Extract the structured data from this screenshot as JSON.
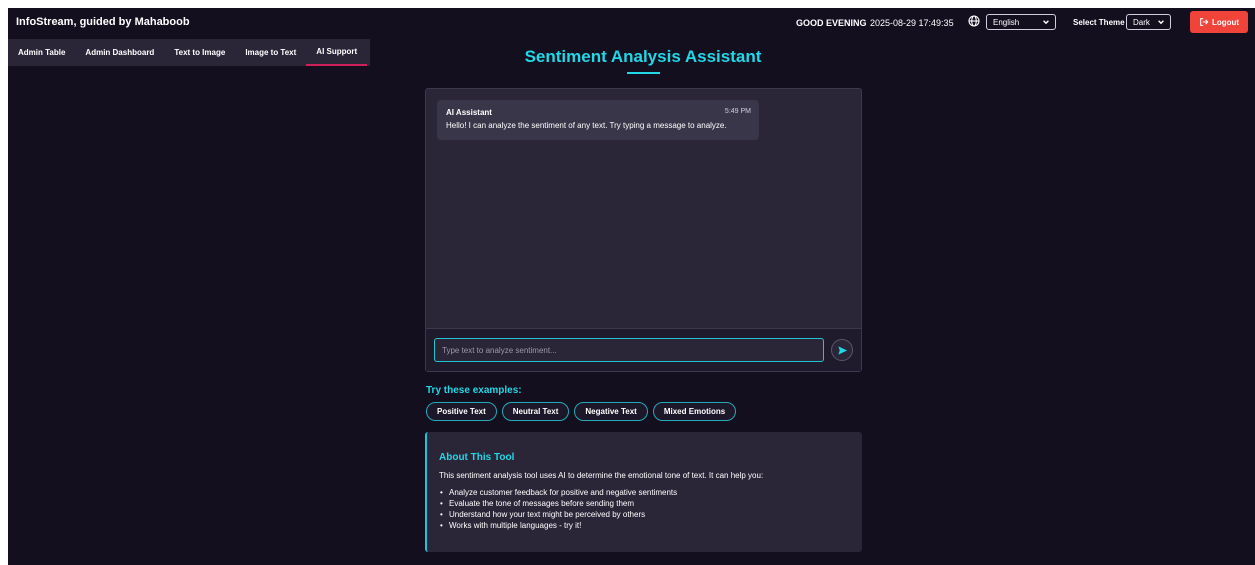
{
  "header": {
    "brand": "InfoStream, guided by Mahaboob",
    "greeting": "GOOD EVENING",
    "datetime": "2025-08-29 17:49:35",
    "language": "English",
    "theme_label": "Select Theme",
    "theme": "Dark",
    "logout_label": "Logout"
  },
  "nav": {
    "items": [
      {
        "label": "Admin Table"
      },
      {
        "label": "Admin Dashboard"
      },
      {
        "label": "Text to Image"
      },
      {
        "label": "Image to Text"
      },
      {
        "label": "AI Support"
      }
    ]
  },
  "main": {
    "title": "Sentiment Analysis Assistant",
    "chat": {
      "sender": "AI Assistant",
      "time": "5:49 PM",
      "message": "Hello! I can analyze the sentiment of any text. Try typing a message to analyze.",
      "input_placeholder": "Type text to analyze sentiment..."
    },
    "examples": {
      "label": "Try these examples:",
      "chips": [
        "Positive Text",
        "Neutral Text",
        "Negative Text",
        "Mixed Emotions"
      ]
    },
    "about": {
      "title": "About This Tool",
      "description": "This sentiment analysis tool uses AI to determine the emotional tone of text. It can help you:",
      "points": [
        "Analyze customer feedback for positive and negative sentiments",
        "Evaluate the tone of messages before sending them",
        "Understand how your text might be perceived by others",
        "Works with multiple languages - try it!"
      ]
    }
  },
  "colors": {
    "background": "#130f1f",
    "panel": "#2a2638",
    "accent": "#22d7e6",
    "logout": "#f0433a",
    "active_tab": "#d0205a"
  }
}
